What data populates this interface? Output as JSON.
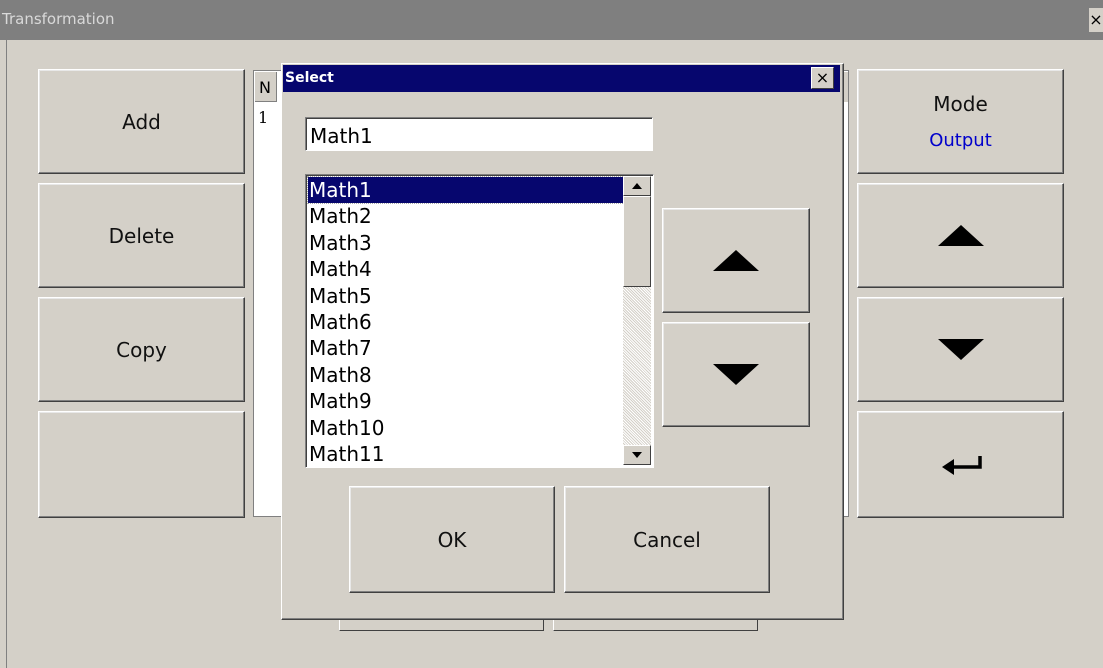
{
  "window": {
    "title": "Transformation",
    "close_label": "×"
  },
  "left_buttons": {
    "add": "Add",
    "delete": "Delete",
    "copy": "Copy",
    "empty": ""
  },
  "right_panel": {
    "mode_label": "Mode",
    "mode_value": "Output",
    "mode_value_color": "#0000cc"
  },
  "table": {
    "header_first": "N",
    "rows": [
      "1"
    ]
  },
  "dialog": {
    "title": "Select",
    "close_label": "×",
    "input_value": "Math1",
    "list_items": [
      "Math1",
      "Math2",
      "Math3",
      "Math4",
      "Math5",
      "Math6",
      "Math7",
      "Math8",
      "Math9",
      "Math10",
      "Math11"
    ],
    "selected_index": 0,
    "ok_label": "OK",
    "cancel_label": "Cancel"
  },
  "colors": {
    "dialog_title_bg": "#06066e",
    "window_title_bg": "#7f7f7f",
    "face": "#d4d0c8"
  },
  "icons": [
    "arrow-up-icon",
    "arrow-down-icon",
    "enter-return-icon",
    "close-icon",
    "scroll-up-icon",
    "scroll-down-icon"
  ]
}
